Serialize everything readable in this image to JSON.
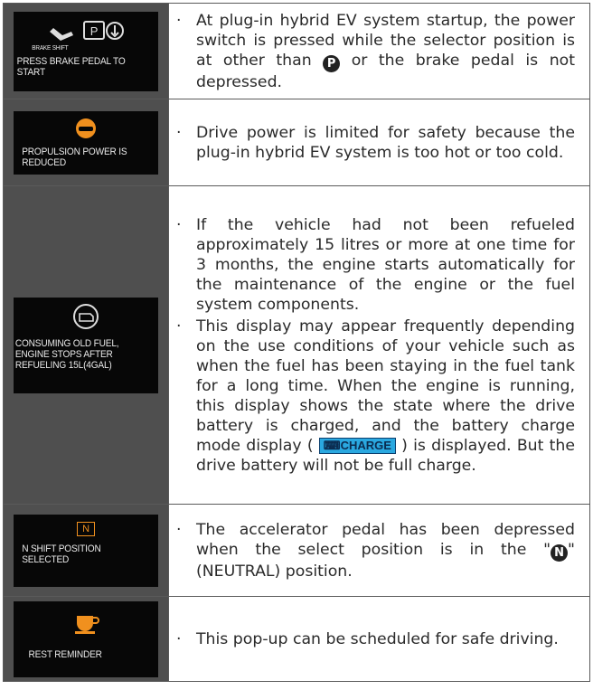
{
  "rows": [
    {
      "panel_top": "BRAKE SHIFT",
      "panel_caption": "PRESS BRAKE PEDAL TO START",
      "text_a": "At plug-in hybrid EV system startup, the power switch is pressed while the selector position is at other than ",
      "symbol": "P",
      "text_b": " or the brake pedal is not depressed."
    },
    {
      "panel_caption": "PROPULSION POWER IS REDUCED",
      "text": "Drive power is limited for safety because the plug-in hybrid EV system is too hot or too cold."
    },
    {
      "panel_caption": "CONSUMING OLD FUEL, ENGINE STOPS AFTER REFUELING 15L(4GAL)",
      "bullet1": "If the vehicle had not been refueled approximately 15 litres or more at one time for 3 months, the engine starts automatically for the maintenance of the engine or the fuel system components.",
      "bullet2_a": "This display may appear frequently depending on the use conditions of your vehicle such as when the fuel has been staying in the fuel tank for a long time. When the engine is running, this display shows the state where the drive battery is charged, and the battery charge mode display ( ",
      "badge": "CHARGE",
      "bullet2_b": " ) is displayed. But the drive battery will not be full charge."
    },
    {
      "panel_symbol": "N",
      "panel_caption": "N SHIFT POSITION SELECTED",
      "text_a": "The accelerator pedal has been depressed when the select position is in the \"",
      "symbol": "N",
      "text_b": "\" (NEUTRAL) position."
    },
    {
      "panel_caption": "REST REMINDER",
      "text": "This pop-up can be scheduled for safe driving."
    }
  ],
  "bullet_char": "·",
  "colors": {
    "panel_bg": "#070707",
    "cell_bg": "#4f4f4f",
    "accent_orange": "#f0901e",
    "charge_blue": "#2aa8e0"
  }
}
